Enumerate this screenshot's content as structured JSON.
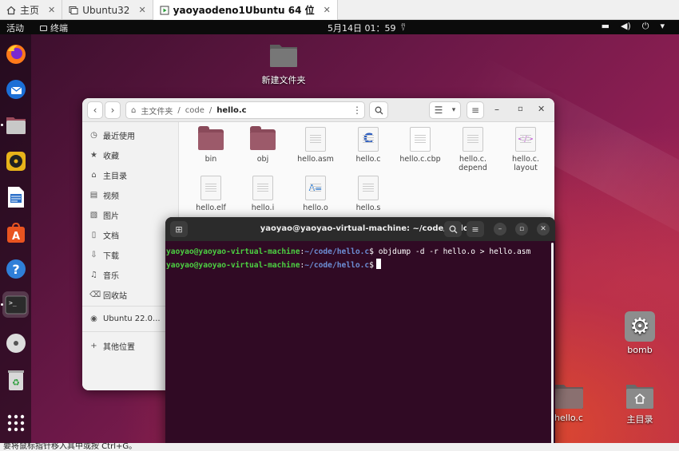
{
  "host_tabs": [
    {
      "label": "主页",
      "icon": "home-icon"
    },
    {
      "label": "Ubuntu32",
      "icon": "vm-icon"
    },
    {
      "label": "yaoyaodeno1Ubuntu 64 位",
      "icon": "vm-play-icon",
      "active": true
    }
  ],
  "topbar": {
    "activities": "活动",
    "app": "终端",
    "clock": "5月14日  01：59"
  },
  "desktop_icons": {
    "new_folder": "新建文件夹",
    "bomb": "bomb",
    "hello_c": "hello.c",
    "home": "主目录"
  },
  "file_manager": {
    "path": [
      "主文件夹",
      "code",
      "hello.c"
    ],
    "sidebar": [
      {
        "label": "最近使用",
        "icon": "clock-icon"
      },
      {
        "label": "收藏",
        "icon": "star-icon"
      },
      {
        "label": "主目录",
        "icon": "home-icon"
      },
      {
        "label": "视频",
        "icon": "video-icon"
      },
      {
        "label": "图片",
        "icon": "image-icon"
      },
      {
        "label": "文档",
        "icon": "document-icon"
      },
      {
        "label": "下载",
        "icon": "download-icon"
      },
      {
        "label": "音乐",
        "icon": "music-icon"
      },
      {
        "label": "回收站",
        "icon": "trash-icon"
      },
      {
        "label": "Ubuntu 22.0...",
        "icon": "disc-icon"
      },
      {
        "label": "其他位置",
        "icon": "plus-icon"
      }
    ],
    "files": [
      {
        "name": "bin",
        "type": "folder"
      },
      {
        "name": "obj",
        "type": "folder"
      },
      {
        "name": "hello.asm",
        "type": "text"
      },
      {
        "name": "hello.c",
        "type": "c-source"
      },
      {
        "name": "hello.c.cbp",
        "type": "blank"
      },
      {
        "name": "hello.c.\ndepend",
        "type": "text"
      },
      {
        "name": "hello.c.\nlayout",
        "type": "xml"
      },
      {
        "name": "hello.elf",
        "type": "text"
      },
      {
        "name": "hello.i",
        "type": "text"
      },
      {
        "name": "hello.o",
        "type": "object"
      },
      {
        "name": "hello.s",
        "type": "text"
      }
    ]
  },
  "terminal": {
    "title": "yaoyao@yaoyao-virtual-machine: ~/code/hello.c",
    "lines": [
      {
        "user_host": "yaoyao@yaoyao-virtual-machine",
        "path": "~/code/hello.c",
        "prompt": "$",
        "cmd": " objdump -d -r hello.o > hello.asm"
      },
      {
        "user_host": "yaoyao@yaoyao-virtual-machine",
        "path": "~/code/hello.c",
        "prompt": "$",
        "cmd": ""
      }
    ]
  },
  "status_bar": "要将鼠标指针移入其中或按 Ctrl+G。"
}
